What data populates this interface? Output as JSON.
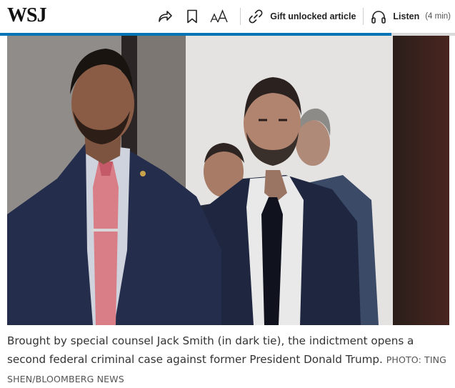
{
  "header": {
    "logo": "WSJ",
    "toolbar": {
      "share_icon": "share-icon",
      "bookmark_icon": "bookmark-icon",
      "text_size_icon": "text-size-icon",
      "gift_icon": "link-icon",
      "gift_label": "Gift unlocked article",
      "listen_icon": "headphones-icon",
      "listen_label": "Listen",
      "listen_duration": "(4 min)"
    },
    "reading_progress": 0.86,
    "progress_color": "#0274b6"
  },
  "photo": {
    "subject": "Jack Smith walking with aides in a hallway"
  },
  "caption": {
    "text": "Brought by special counsel Jack Smith (in dark tie), the indictment opens a second federal criminal case against former President Donald Trump.",
    "credit": "PHOTO: TING SHEN/BLOOMBERG NEWS"
  }
}
